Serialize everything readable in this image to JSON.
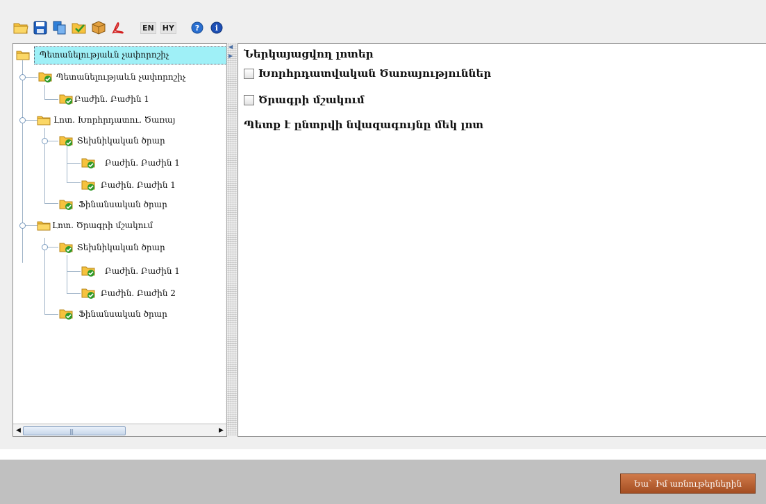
{
  "toolbar": {
    "buttons": [
      "open-folder-icon",
      "save-icon",
      "copy-icon",
      "approve-icon",
      "package-icon",
      "pdf-icon"
    ],
    "lang_en": "EN",
    "lang_hy": "HY",
    "help_icon": "help-icon",
    "info_icon": "info-icon"
  },
  "tree": {
    "items": [
      {
        "label": "Պետանելությաևն չափորոշիչ",
        "icon": "folder-icon",
        "selected": true
      },
      {
        "label": "Պետանելությաևն չափորոշիչ",
        "icon": "folder-check-icon"
      },
      {
        "label": "Բաժին. Բաժին 1",
        "icon": "folder-check-icon"
      },
      {
        "label": "Լոտ. Խորհրդատու. Ծառայ",
        "icon": "folder-icon"
      },
      {
        "label": "Տեխնիկական ծրար",
        "icon": "folder-check-icon"
      },
      {
        "label": "Բաժին. Բաժին 1",
        "icon": "folder-check-icon"
      },
      {
        "label": "Բաժին. Բաժին 1",
        "icon": "folder-check-icon"
      },
      {
        "label": "Ֆինանսական ծրար",
        "icon": "folder-check-icon"
      },
      {
        "label": "Լոտ. Ծրագրի մշակում",
        "icon": "folder-icon"
      },
      {
        "label": "Տեխնիկական ծրար",
        "icon": "folder-check-icon"
      },
      {
        "label": "Բաժին. Բաժին 1",
        "icon": "folder-check-icon"
      },
      {
        "label": "Բաժին. Բաժին 2",
        "icon": "folder-check-icon"
      },
      {
        "label": "Ֆինանսական ծրար",
        "icon": "folder-check-icon"
      }
    ]
  },
  "right": {
    "heading": "Ներկայացվող լոտեր",
    "checkboxes": [
      {
        "label": "Խորհրդատվական Ծառայություններ",
        "checked": false
      },
      {
        "label": "Ծրագրի մշակում",
        "checked": false
      }
    ],
    "warning": "Պետք է ընտրվի նվազագույնը մեկ լոտ"
  },
  "footer": {
    "next_button": "Եա` Իմ առնութերներին"
  },
  "colors": {
    "selection": "#9ff0f7",
    "next_button": "#b65a2c",
    "footer_bg": "#c0c0c0"
  }
}
